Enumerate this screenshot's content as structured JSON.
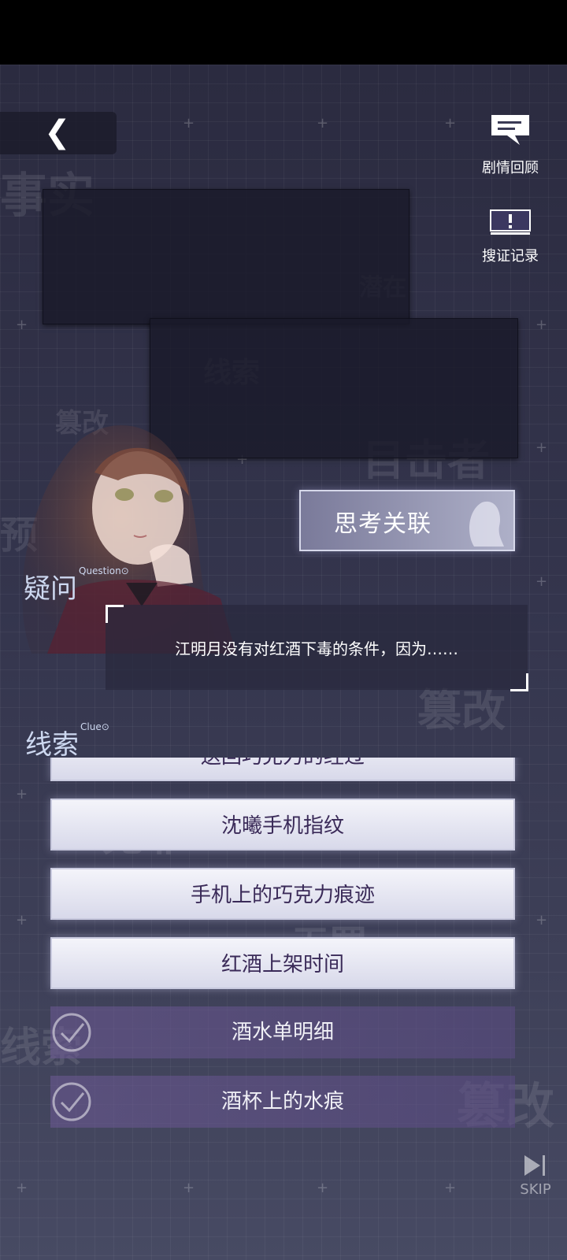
{
  "top_right": {
    "story_review_label": "剧情回顾",
    "evidence_log_label": "搜证记录"
  },
  "think_button": {
    "label": "思考关联"
  },
  "question": {
    "title": "疑问",
    "title_sup": "Question⊙",
    "text": "江明月没有对红酒下毒的条件，因为……"
  },
  "clues": {
    "title": "线索",
    "title_sup": "Clue⊙",
    "partial_item": "送回巧克力的经过",
    "items": [
      {
        "label": "沈曦手机指纹",
        "state": "active"
      },
      {
        "label": "手机上的巧克力痕迹",
        "state": "active"
      },
      {
        "label": "红酒上架时间",
        "state": "active"
      },
      {
        "label": "酒水单明细",
        "state": "used"
      },
      {
        "label": "酒杯上的水痕",
        "state": "used"
      }
    ]
  },
  "skip_label": "SKIP",
  "background_words": [
    "事实",
    "潜在",
    "线索",
    "目击者",
    "篡改",
    "预",
    "篡改",
    "无罪",
    "无罪",
    "线索",
    "篡改"
  ],
  "colors": {
    "background_top": "#2b2b40",
    "background_bottom": "#474a63",
    "clue_active_bg": "#eeeef6",
    "clue_active_text": "#3a2a58",
    "clue_used_bg": "#6e5a96"
  }
}
